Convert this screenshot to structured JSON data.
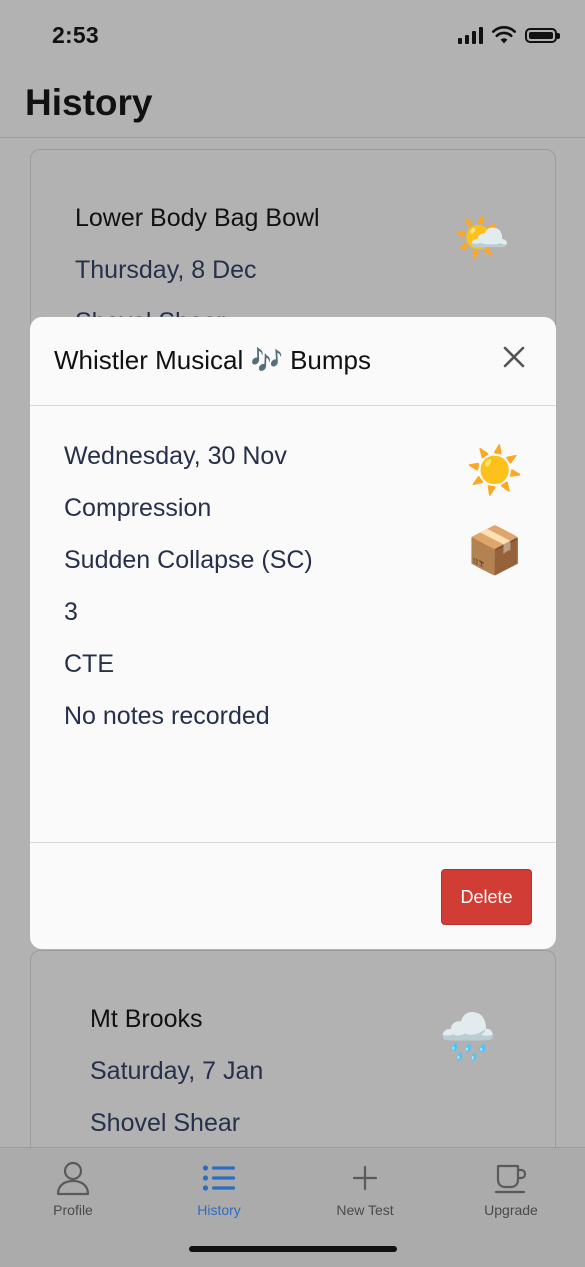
{
  "status_bar": {
    "time": "2:53"
  },
  "header": {
    "title": "History"
  },
  "background_cards": [
    {
      "title": "Lower Body Bag Bowl",
      "date": "Thursday, 8 Dec",
      "detail": "Shovel Shear",
      "weather_emoji": "🌤️"
    },
    {
      "title": "Mt Brooks",
      "date": "Saturday, 7 Jan",
      "detail": "Shovel Shear",
      "weather_emoji": "🌧️"
    }
  ],
  "modal": {
    "title": "Whistler Musical 🎶 Bumps",
    "date": "Wednesday, 30 Nov",
    "test_type": "Compression",
    "result": "Sudden Collapse (SC)",
    "score": "3",
    "code": "CTE",
    "notes": "No notes recorded",
    "weather_emoji": "☀️",
    "test_emoji": "📦",
    "delete_label": "Delete",
    "close_icon": "close-icon"
  },
  "tab_bar": {
    "items": [
      {
        "label": "Profile",
        "icon": "person-icon",
        "active": false
      },
      {
        "label": "History",
        "icon": "list-icon",
        "active": true
      },
      {
        "label": "New Test",
        "icon": "plus-icon",
        "active": false
      },
      {
        "label": "Upgrade",
        "icon": "cup-icon",
        "active": false
      }
    ]
  },
  "colors": {
    "accent": "#2e6cc0",
    "delete": "#d13c34",
    "overlay": "#b2b2b2"
  }
}
